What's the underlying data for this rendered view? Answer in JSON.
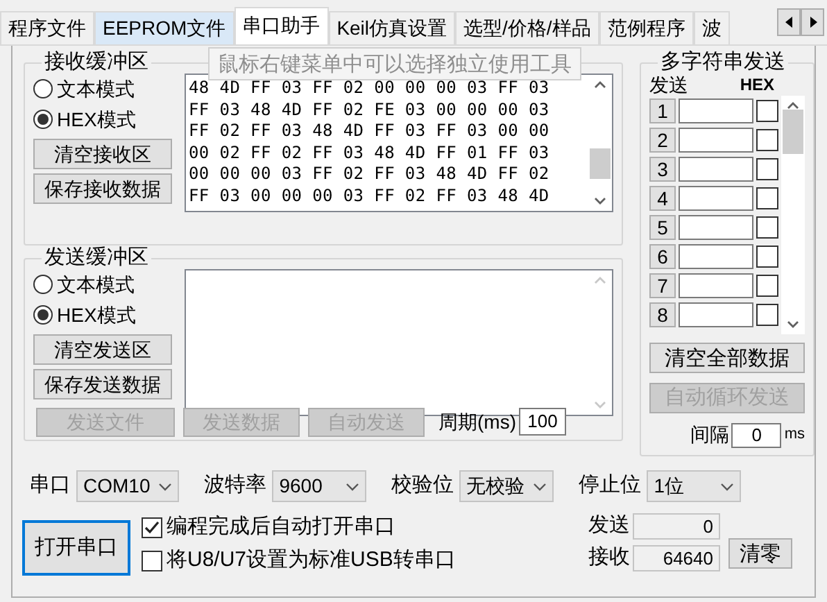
{
  "tabs": [
    {
      "label": "程序文件",
      "selected": false,
      "hovered": false
    },
    {
      "label": "EEPROM文件",
      "selected": false,
      "hovered": true
    },
    {
      "label": "串口助手",
      "selected": true,
      "hovered": false
    },
    {
      "label": "Keil仿真设置",
      "selected": false,
      "hovered": false
    },
    {
      "label": "选型/价格/样品",
      "selected": false,
      "hovered": false
    },
    {
      "label": "范例程序",
      "selected": false,
      "hovered": false
    },
    {
      "label": "波",
      "selected": false,
      "hovered": false
    }
  ],
  "tooltip": "鼠标右键菜单中可以选择独立使用工具",
  "receive": {
    "title": "接收缓冲区",
    "modes": [
      {
        "label": "文本模式",
        "selected": false
      },
      {
        "label": "HEX模式",
        "selected": true
      }
    ],
    "buttons": [
      "清空接收区",
      "保存接收数据"
    ],
    "lines": [
      "48 4D FF 03 FF 02 00 00 00 03 FF 03",
      "FF 03 48 4D FF 02 FE 03 00 00 00 03",
      "FF 02 FF 03 48 4D FF 03 FF 03 00 00",
      "00 02 FF 02 FF 03 48 4D FF 01 FF 03",
      "00 00 00 03 FF 02 FF 03 48 4D FF 02",
      "FF 03 00 00 00 03 FF 02 FF 03 48 4D"
    ]
  },
  "send": {
    "title": "发送缓冲区",
    "modes": [
      {
        "label": "文本模式",
        "selected": false
      },
      {
        "label": "HEX模式",
        "selected": true
      }
    ],
    "buttons": [
      "清空发送区",
      "保存发送数据"
    ],
    "actions": [
      {
        "label": "发送文件",
        "disabled": true
      },
      {
        "label": "发送数据",
        "disabled": true
      },
      {
        "label": "自动发送",
        "disabled": true
      }
    ],
    "period_label": "周期(ms)",
    "period_value": "100"
  },
  "multi": {
    "title": "多字符串发送",
    "send_header": "发送",
    "hex_header": "HEX",
    "rows": [
      {
        "number": "1",
        "hex_checked": false
      },
      {
        "number": "2",
        "hex_checked": false
      },
      {
        "number": "3",
        "hex_checked": false
      },
      {
        "number": "4",
        "hex_checked": false
      },
      {
        "number": "5",
        "hex_checked": false
      },
      {
        "number": "6",
        "hex_checked": false
      },
      {
        "number": "7",
        "hex_checked": false
      },
      {
        "number": "8",
        "hex_checked": false
      }
    ],
    "clear_button": {
      "label": "清空全部数据",
      "disabled": false
    },
    "auto_button": {
      "label": "自动循环发送",
      "disabled": true
    },
    "interval_label": "间隔",
    "interval_value": "0",
    "interval_unit": "ms"
  },
  "settings": [
    {
      "label": "串口",
      "value": "COM10"
    },
    {
      "label": "波特率",
      "value": "9600"
    },
    {
      "label": "校验位",
      "value": "无校验"
    },
    {
      "label": "停止位",
      "value": "1位"
    }
  ],
  "open_button": "打开串口",
  "options": [
    {
      "label": "编程完成后自动打开串口",
      "checked": true
    },
    {
      "label": "将U8/U7设置为标准USB转串口",
      "checked": false
    }
  ],
  "counters": [
    {
      "label": "发送",
      "value": "0"
    },
    {
      "label": "接收",
      "value": "64640"
    }
  ],
  "reset_button": "清零"
}
